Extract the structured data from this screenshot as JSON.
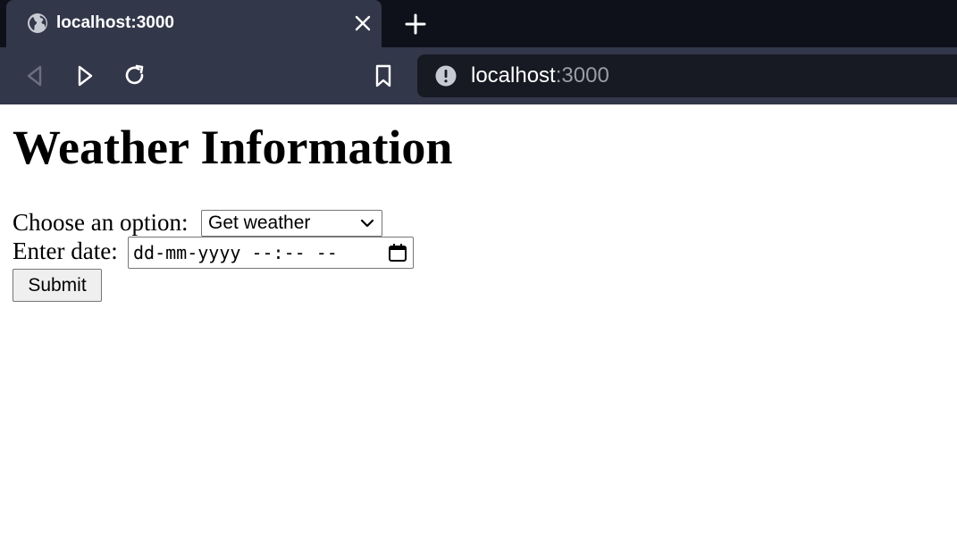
{
  "browser": {
    "tab": {
      "title": "localhost:3000",
      "favicon": "globe-icon",
      "close_icon": "close-icon"
    },
    "new_tab_icon": "plus-icon",
    "nav": {
      "back_icon": "back-icon",
      "forward_icon": "forward-icon",
      "reload_icon": "reload-icon",
      "bookmark_icon": "bookmark-icon"
    },
    "url": {
      "host": "localhost",
      "port": ":3000",
      "info_icon": "info-icon"
    },
    "colors": {
      "tabstrip": "#0f111a",
      "toolbar": "#33374a",
      "urlbar": "#171923"
    }
  },
  "page": {
    "title": "Weather Information",
    "option_label": "Choose an option:",
    "option_select": {
      "selected": "Get weather"
    },
    "date_label": "Enter date:",
    "date_input": {
      "placeholder": "dd-mm-yyyy --:-- --"
    },
    "submit_label": "Submit"
  }
}
